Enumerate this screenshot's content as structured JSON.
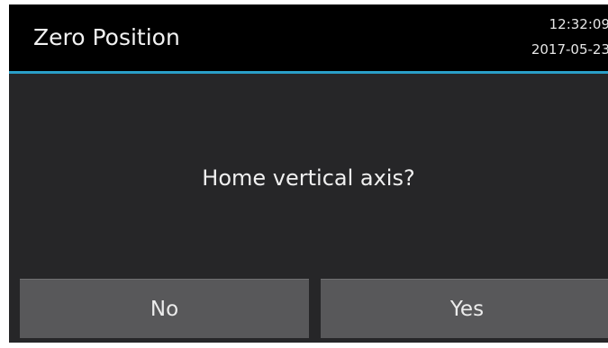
{
  "header": {
    "title": "Zero Position",
    "time": "12:32:09",
    "date": "2017-05-23"
  },
  "dialog": {
    "message": "Home vertical axis?",
    "no_label": "No",
    "yes_label": "Yes"
  },
  "colors": {
    "background": "#262628",
    "header": "#000000",
    "accent": "#2a9fc8",
    "button": "#58585a",
    "text": "#f0f0f0"
  }
}
